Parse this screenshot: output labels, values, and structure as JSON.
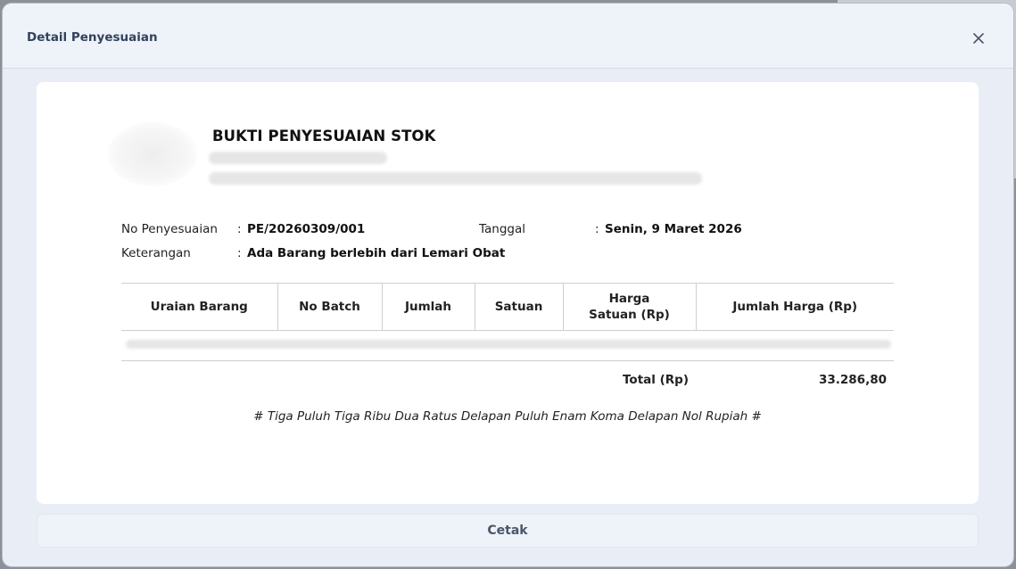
{
  "modal": {
    "title": "Detail Penyesuaian",
    "close_icon": "close-icon"
  },
  "document": {
    "title": "BUKTI PENYESUAIAN STOK",
    "meta": {
      "no_label": "No Penyesuaian",
      "no_value": "PE/20260309/001",
      "date_label": "Tanggal",
      "date_value": "Senin, 9 Maret 2026",
      "note_label": "Keterangan",
      "note_value": "Ada Barang berlebih dari Lemari Obat",
      "colon": ":"
    },
    "table": {
      "headers": [
        "Uraian Barang",
        "No Batch",
        "Jumlah",
        "Satuan",
        "Harga\nSatuan (Rp)",
        "Jumlah Harga (Rp)"
      ],
      "total_label": "Total (Rp)",
      "total_value": "33.286,80"
    },
    "terbilang": "# Tiga Puluh Tiga Ribu Dua Ratus Delapan Puluh Enam Koma Delapan Nol Rupiah #"
  },
  "actions": {
    "print_label": "Cetak"
  }
}
